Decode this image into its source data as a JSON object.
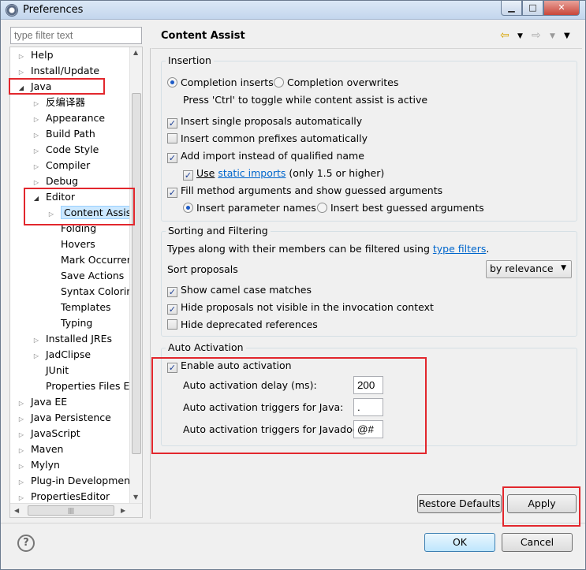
{
  "window": {
    "title": "Preferences"
  },
  "filter": {
    "placeholder": "type filter text"
  },
  "tree": [
    {
      "label": "Help",
      "toggle": "closed"
    },
    {
      "label": "Install/Update",
      "toggle": "closed"
    },
    {
      "label": "Java",
      "toggle": "open"
    },
    {
      "label": "反编译器",
      "toggle": "closed"
    },
    {
      "label": "Appearance",
      "toggle": "closed"
    },
    {
      "label": "Build Path",
      "toggle": "closed"
    },
    {
      "label": "Code Style",
      "toggle": "closed"
    },
    {
      "label": "Compiler",
      "toggle": "closed"
    },
    {
      "label": "Debug",
      "toggle": "closed"
    },
    {
      "label": "Editor",
      "toggle": "open"
    },
    {
      "label": "Content Assist",
      "toggle": "closed",
      "selected": true
    },
    {
      "label": "Folding",
      "toggle": "none"
    },
    {
      "label": "Hovers",
      "toggle": "none"
    },
    {
      "label": "Mark Occurren",
      "toggle": "none"
    },
    {
      "label": "Save Actions",
      "toggle": "none"
    },
    {
      "label": "Syntax Coloring",
      "toggle": "none"
    },
    {
      "label": "Templates",
      "toggle": "none"
    },
    {
      "label": "Typing",
      "toggle": "none"
    },
    {
      "label": "Installed JREs",
      "toggle": "closed"
    },
    {
      "label": "JadClipse",
      "toggle": "closed"
    },
    {
      "label": "JUnit",
      "toggle": "none"
    },
    {
      "label": "Properties Files Ed",
      "toggle": "none"
    },
    {
      "label": "Java EE",
      "toggle": "closed"
    },
    {
      "label": "Java Persistence",
      "toggle": "closed"
    },
    {
      "label": "JavaScript",
      "toggle": "closed"
    },
    {
      "label": "Maven",
      "toggle": "closed"
    },
    {
      "label": "Mylyn",
      "toggle": "closed"
    },
    {
      "label": "Plug-in Development",
      "toggle": "closed"
    },
    {
      "label": "PropertiesEditor",
      "toggle": "closed"
    }
  ],
  "page": {
    "title": "Content Assist"
  },
  "insertion": {
    "label": "Insertion",
    "completion_inserts": "Completion inserts",
    "completion_overwrites": "Completion overwrites",
    "toggle_hint": "Press 'Ctrl' to toggle while content assist is active",
    "single_proposals": "Insert single proposals automatically",
    "common_prefixes": "Insert common prefixes automatically",
    "add_import": "Add import instead of qualified name",
    "use": "Use",
    "static_imports": "static imports",
    "only_15": "(only 1.5 or higher)",
    "fill_method": "Fill method arguments and show guessed arguments",
    "param_names": "Insert parameter names",
    "best_guessed": "Insert best guessed arguments"
  },
  "sorting": {
    "label": "Sorting and Filtering",
    "types_text": "Types along with their members can be filtered using",
    "type_filters": "type filters",
    "period": ".",
    "sort_proposals": "Sort proposals",
    "sort_value": "by relevance",
    "camel_case": "Show camel case matches",
    "hide_not_visible": "Hide proposals not visible in the invocation context",
    "hide_deprecated": "Hide deprecated references"
  },
  "auto": {
    "label": "Auto Activation",
    "enable": "Enable auto activation",
    "delay_label": "Auto activation delay (ms):",
    "delay_value": "200",
    "java_label": "Auto activation triggers for Java:",
    "java_value": ".",
    "javadoc_label": "Auto activation triggers for Javadoc:",
    "javadoc_value": "@#"
  },
  "buttons": {
    "restore": "Restore Defaults",
    "apply": "Apply",
    "ok": "OK",
    "cancel": "Cancel"
  },
  "icons": {
    "window_min": "minimize-icon",
    "window_max": "maximize-icon",
    "window_close": "close-icon",
    "help": "help-icon",
    "nav_back": "back-arrow-icon",
    "nav_forward": "forward-arrow-icon",
    "menu": "view-menu-icon"
  }
}
